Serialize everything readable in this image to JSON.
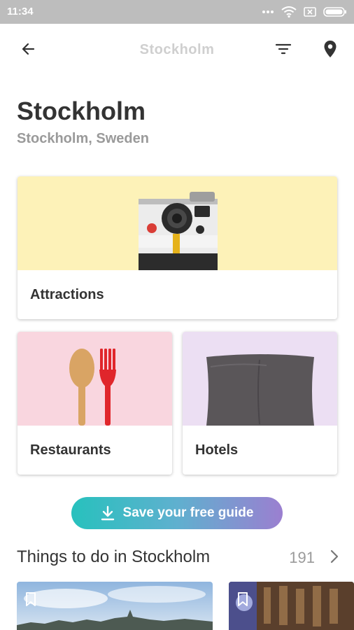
{
  "status_bar": {
    "time": "11:34"
  },
  "toolbar": {
    "title": "Stockholm"
  },
  "header": {
    "city": "Stockholm",
    "subtitle": "Stockholm, Sweden"
  },
  "categories": [
    {
      "label": "Attractions",
      "icon": "camera-image",
      "bg": "#fdf2b8"
    },
    {
      "label": "Restaurants",
      "icon": "spoon-fork-image",
      "bg": "#f9d6df"
    },
    {
      "label": "Hotels",
      "icon": "pillow-image",
      "bg": "#ecdff3"
    }
  ],
  "save_button": {
    "label": "Save your free guide"
  },
  "things_section": {
    "title": "Things to do in Stockholm",
    "count": "191"
  },
  "colors": {
    "accent_start": "#27c1bd",
    "accent_end": "#9b7fd0"
  }
}
